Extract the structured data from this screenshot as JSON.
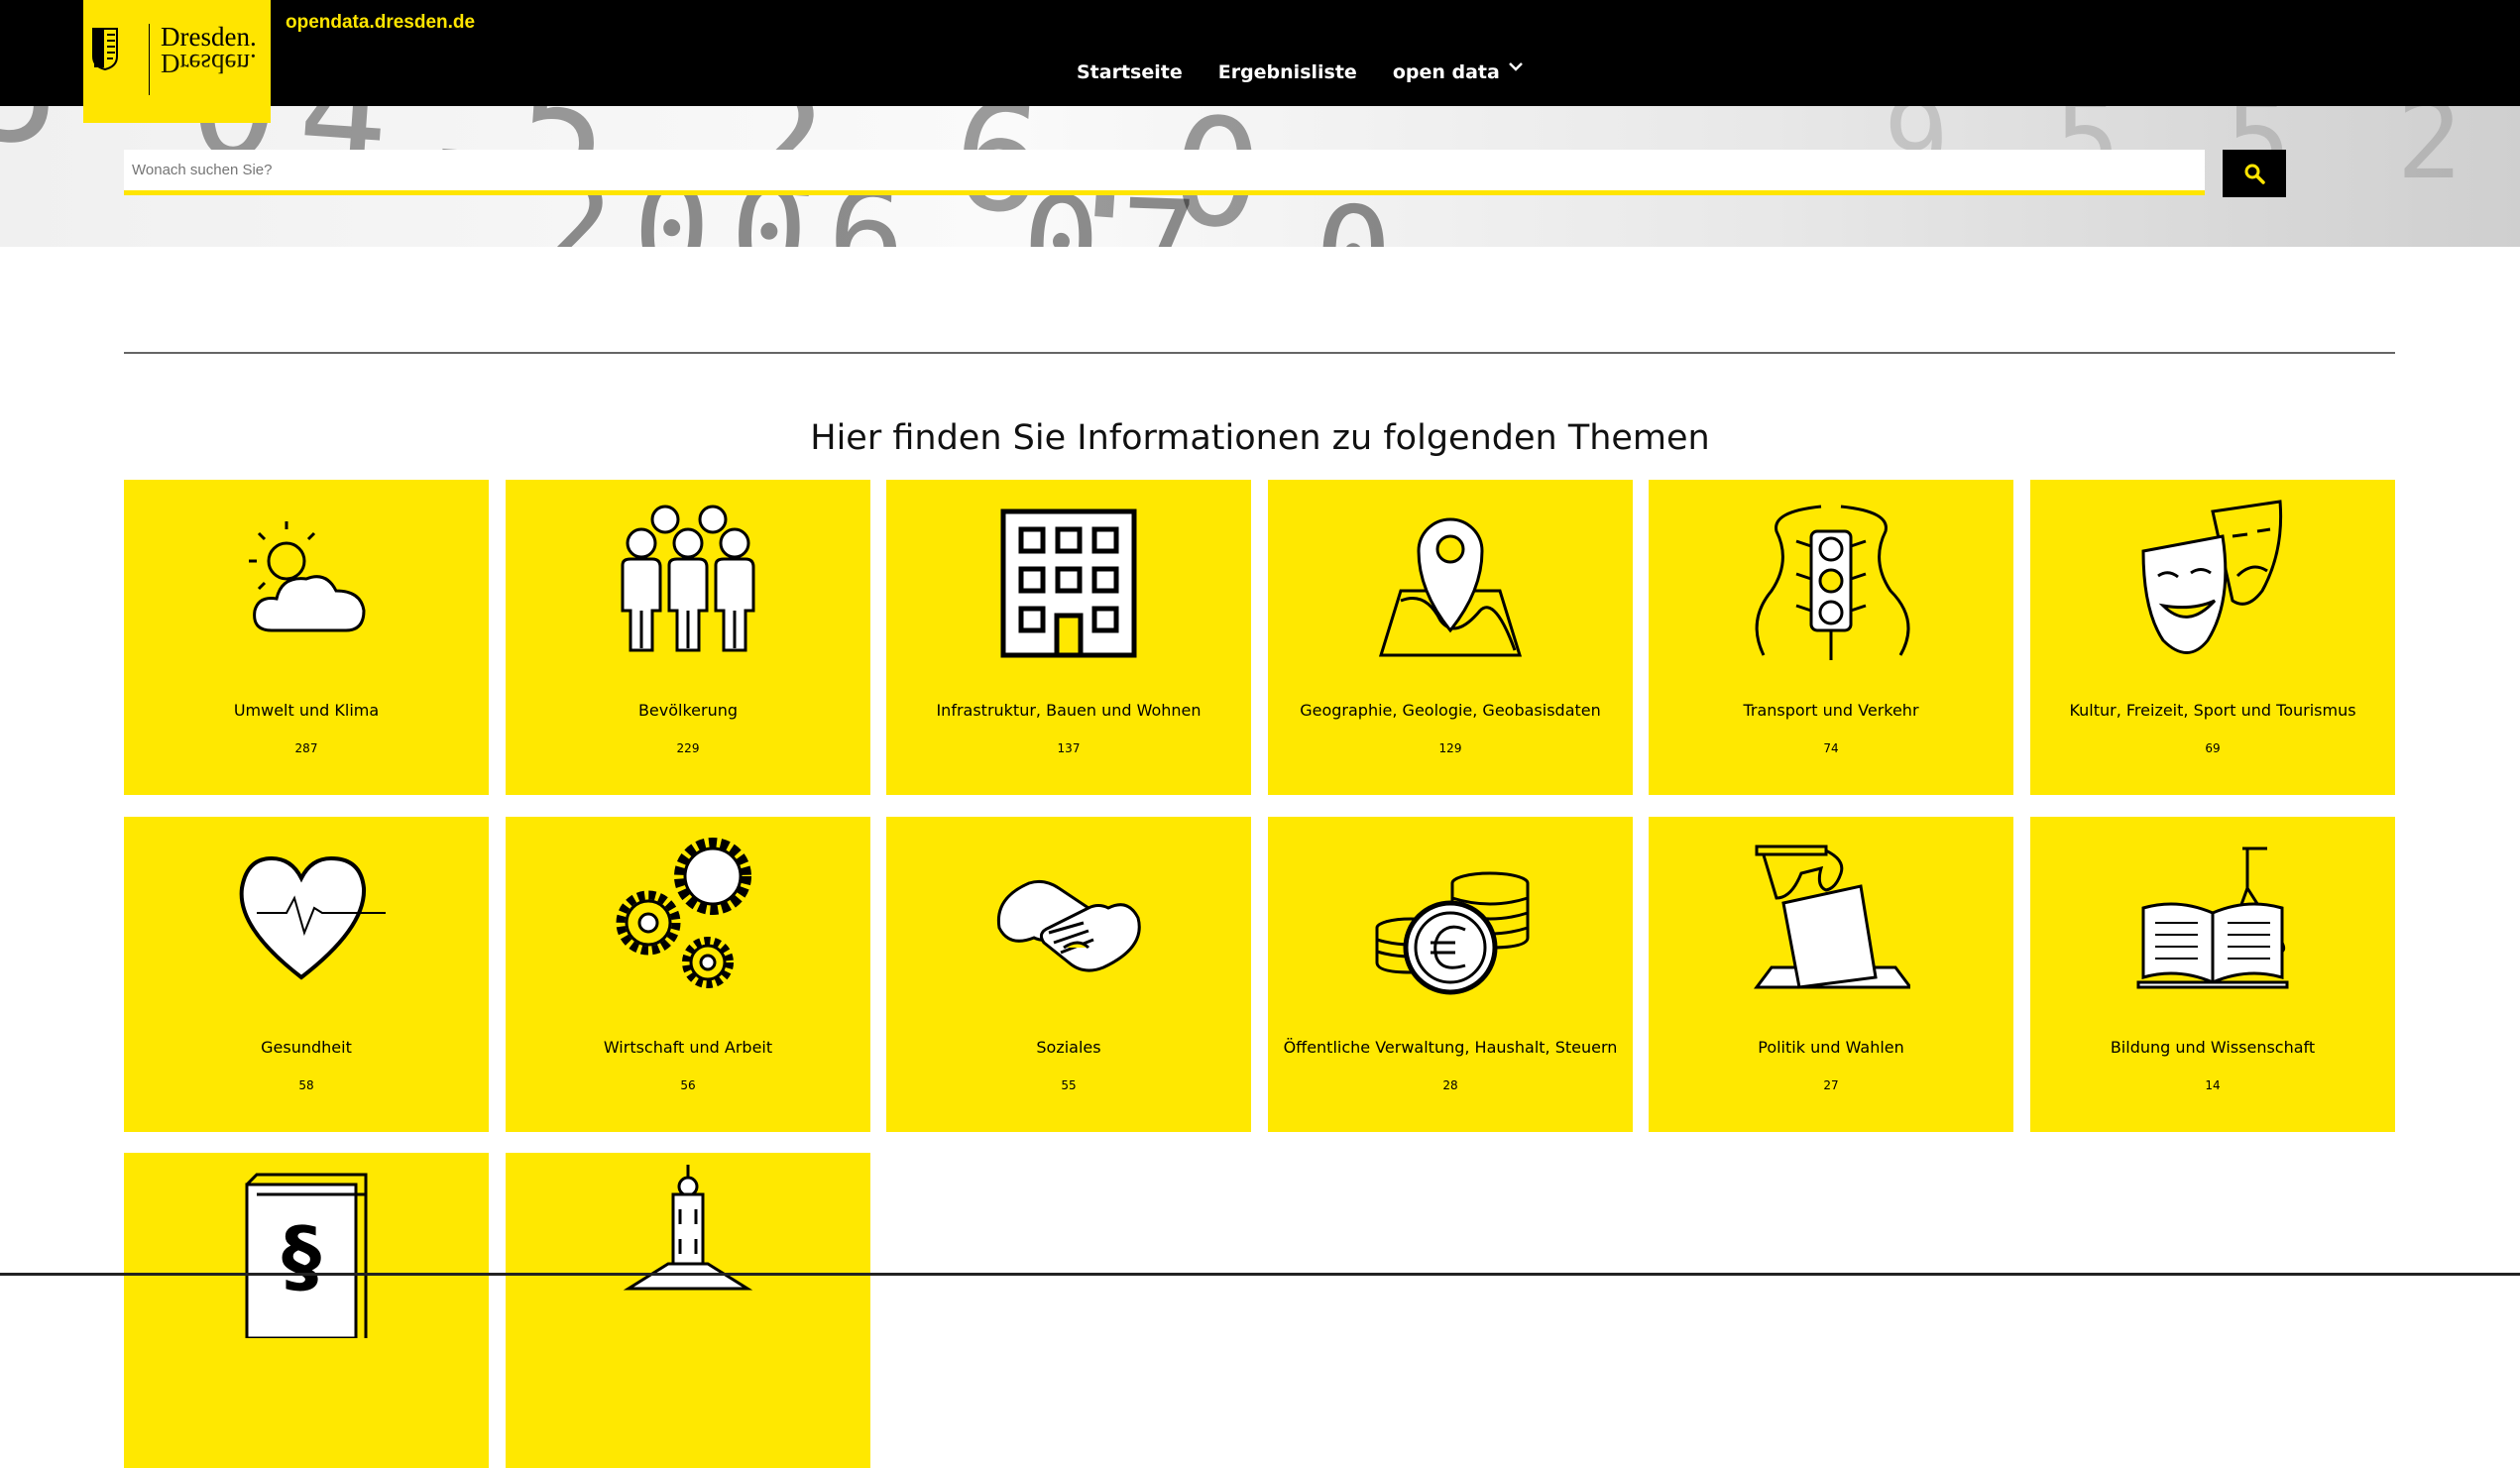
{
  "header": {
    "logo_text": "Dresden.",
    "site_url": "opendata.dresden.de",
    "nav": [
      {
        "label": "Startseite"
      },
      {
        "label": "Ergebnisliste"
      },
      {
        "label": "open data"
      }
    ]
  },
  "search": {
    "placeholder": "Wonach suchen Sie?"
  },
  "section_title": "Hier finden Sie Informationen zu folgenden Themen",
  "topics": [
    {
      "label": "Umwelt und Klima",
      "count": "287",
      "icon": "weather-icon"
    },
    {
      "label": "Bevölkerung",
      "count": "229",
      "icon": "people-icon"
    },
    {
      "label": "Infrastruktur, Bauen und Wohnen",
      "count": "137",
      "icon": "building-icon"
    },
    {
      "label": "Geographie, Geologie, Geobasisdaten",
      "count": "129",
      "icon": "map-pin-icon"
    },
    {
      "label": "Transport und Verkehr",
      "count": "74",
      "icon": "traffic-light-icon"
    },
    {
      "label": "Kultur, Freizeit, Sport und Tourismus",
      "count": "69",
      "icon": "theater-masks-icon"
    },
    {
      "label": "Gesundheit",
      "count": "58",
      "icon": "heart-pulse-icon"
    },
    {
      "label": "Wirtschaft und Arbeit",
      "count": "56",
      "icon": "gears-icon"
    },
    {
      "label": "Soziales",
      "count": "55",
      "icon": "handshake-icon"
    },
    {
      "label": "Öffentliche Verwaltung, Haushalt, Steuern",
      "count": "28",
      "icon": "coins-icon"
    },
    {
      "label": "Politik und Wahlen",
      "count": "27",
      "icon": "ballot-icon"
    },
    {
      "label": "Bildung und Wissenschaft",
      "count": "14",
      "icon": "book-flask-icon"
    },
    {
      "label": "",
      "count": "",
      "icon": "law-book-icon"
    },
    {
      "label": "",
      "count": "",
      "icon": "town-hall-icon"
    }
  ],
  "colors": {
    "accent": "#ffe500",
    "header_bg": "#000000"
  }
}
